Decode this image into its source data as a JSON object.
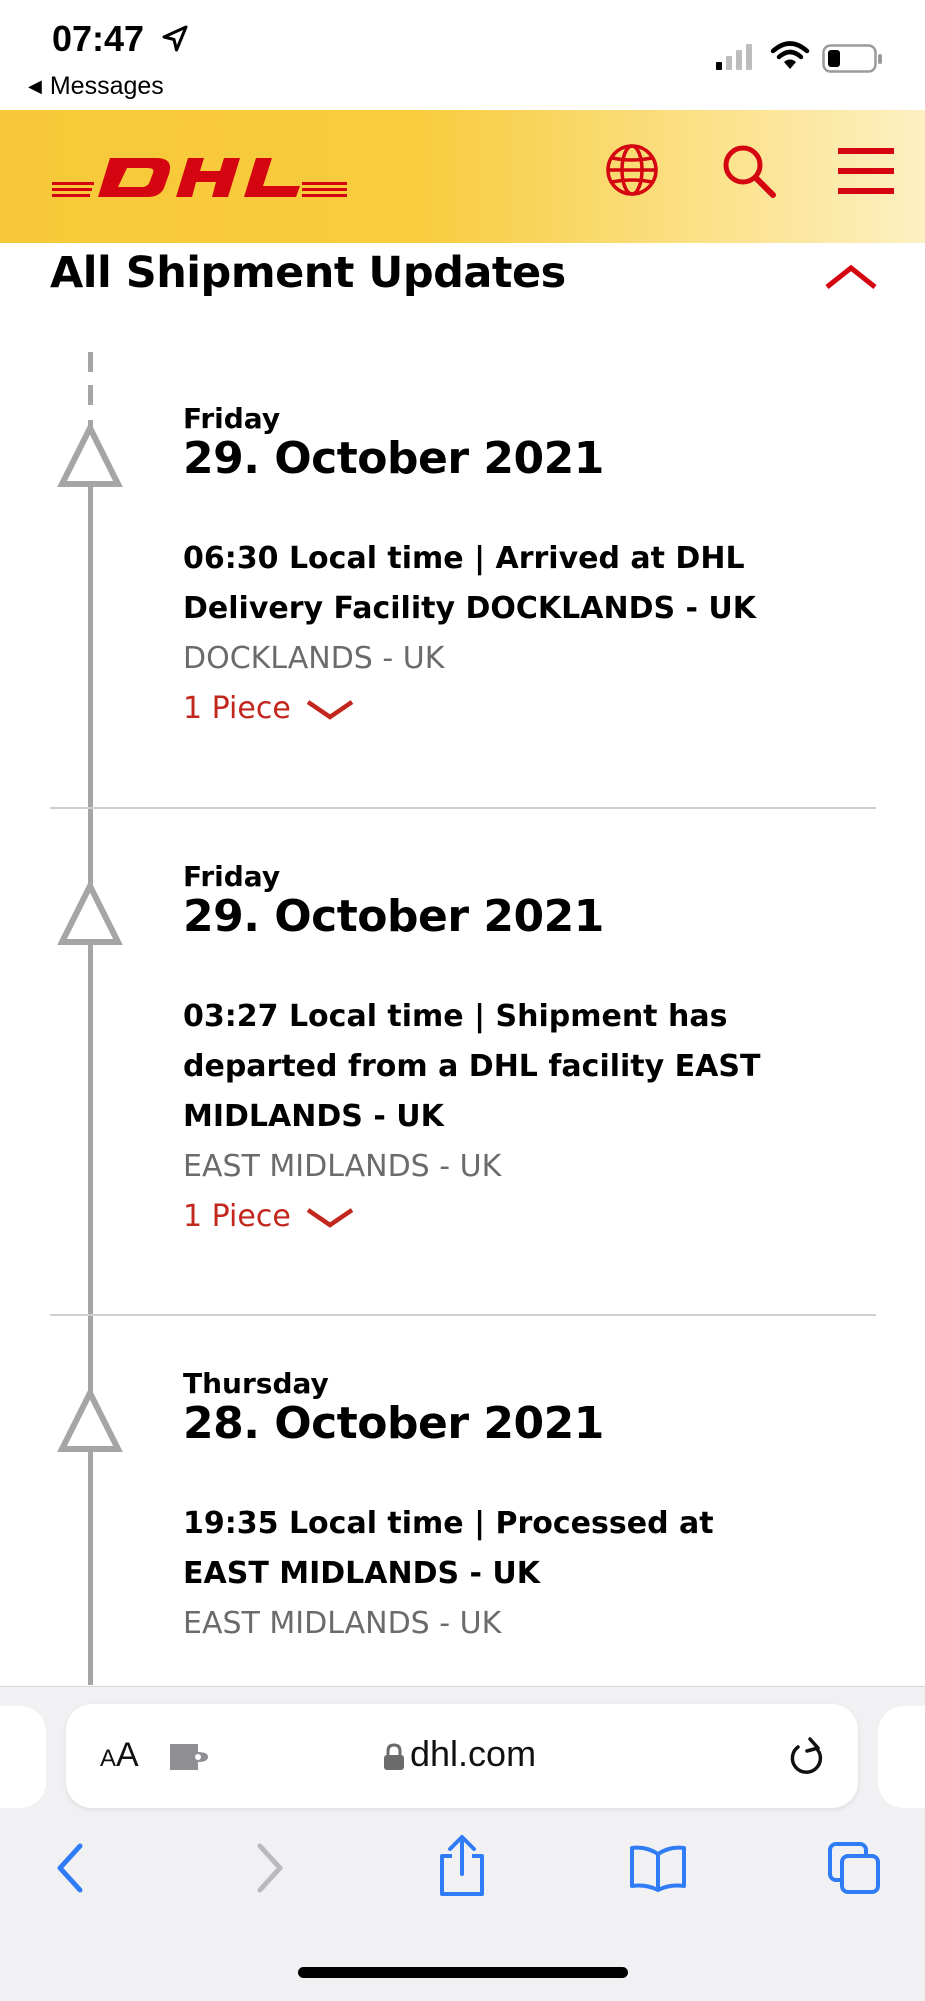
{
  "status_bar": {
    "time": "07:47",
    "back_label": "Messages"
  },
  "header": {
    "brand": "DHL",
    "icons": [
      "globe-icon",
      "search-icon",
      "menu-icon"
    ],
    "brand_color": "#d40511",
    "header_color": "#ffcc00"
  },
  "section": {
    "title": "All Shipment Updates"
  },
  "events": [
    {
      "weekday": "Friday",
      "date": "29. October 2021",
      "description": "06:30 Local time | Arrived at DHL Delivery Facility DOCKLANDS - UK",
      "location": "DOCKLANDS - UK",
      "pieces": "1 Piece"
    },
    {
      "weekday": "Friday",
      "date": "29. October 2021",
      "description": "03:27 Local time | Shipment has departed from a DHL facility EAST MIDLANDS - UK",
      "location": "EAST MIDLANDS - UK",
      "pieces": "1 Piece"
    },
    {
      "weekday": "Thursday",
      "date": "28. October 2021",
      "description": "19:35 Local time | Processed at EAST MIDLANDS - UK",
      "location": "EAST MIDLANDS - UK",
      "pieces": ""
    }
  ],
  "browser": {
    "text_size_label_small": "A",
    "text_size_label_big": "A",
    "url": "dhl.com",
    "toolbar_icons": [
      "back-icon",
      "forward-icon",
      "share-icon",
      "bookmarks-icon",
      "tabs-icon"
    ]
  }
}
